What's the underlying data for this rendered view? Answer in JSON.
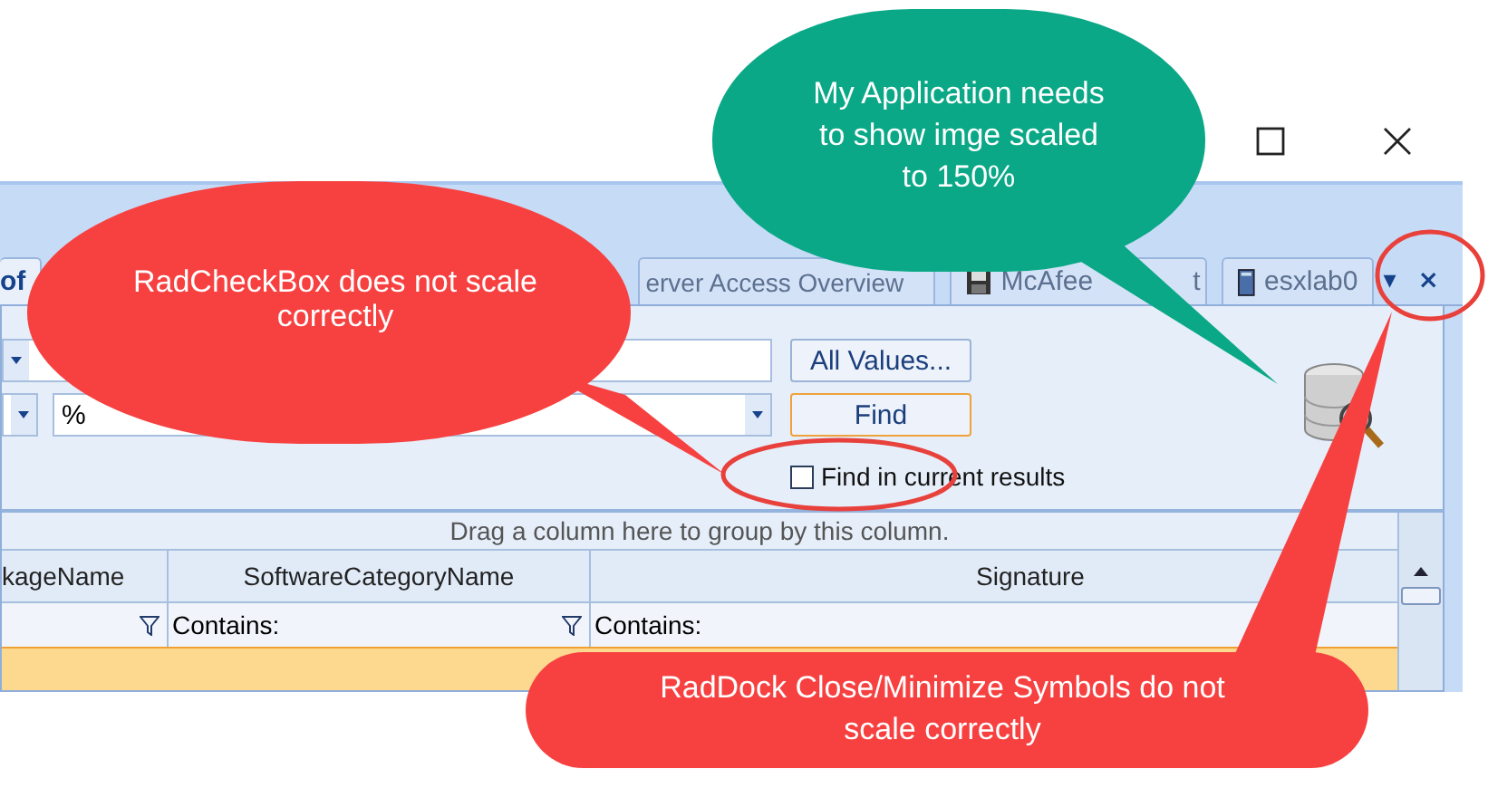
{
  "tabs": [
    {
      "label": "of",
      "kind": "plain",
      "selected": true
    },
    {
      "label": "erver Access Overview",
      "kind": "plain",
      "selected": false
    },
    {
      "label": "McAfee",
      "kind": "disk",
      "selected": false
    },
    {
      "label": "t",
      "kind": "cut",
      "selected": false
    },
    {
      "label": "esxlab0",
      "kind": "server",
      "selected": false
    }
  ],
  "dock_buttons": [
    "▾",
    "×"
  ],
  "search": {
    "value_field": "%",
    "all_values_button": "All Values...",
    "find_button": "Find",
    "find_in_current": {
      "label": "Find in current results",
      "checked": false
    }
  },
  "grid": {
    "group_panel": "Drag a column here to group by this column.",
    "columns": [
      {
        "header": "kageName",
        "funnel": true
      },
      {
        "header": "SoftwareCategoryName",
        "filter": "Contains:",
        "funnel": true
      },
      {
        "header": "Signature",
        "filter": "Contains:",
        "funnel": false
      }
    ],
    "rows": [
      {
        "selected": true
      }
    ]
  },
  "callouts": [
    {
      "text": "My Application needs to show imge scaled to 150%",
      "color": "#0aa886"
    },
    {
      "text": "RadCheckBox does not scale correctly",
      "color": "#f74141"
    },
    {
      "text": "RadDock Close/Minimize Symbols do not scale correctly",
      "color": "#f74141"
    }
  ]
}
